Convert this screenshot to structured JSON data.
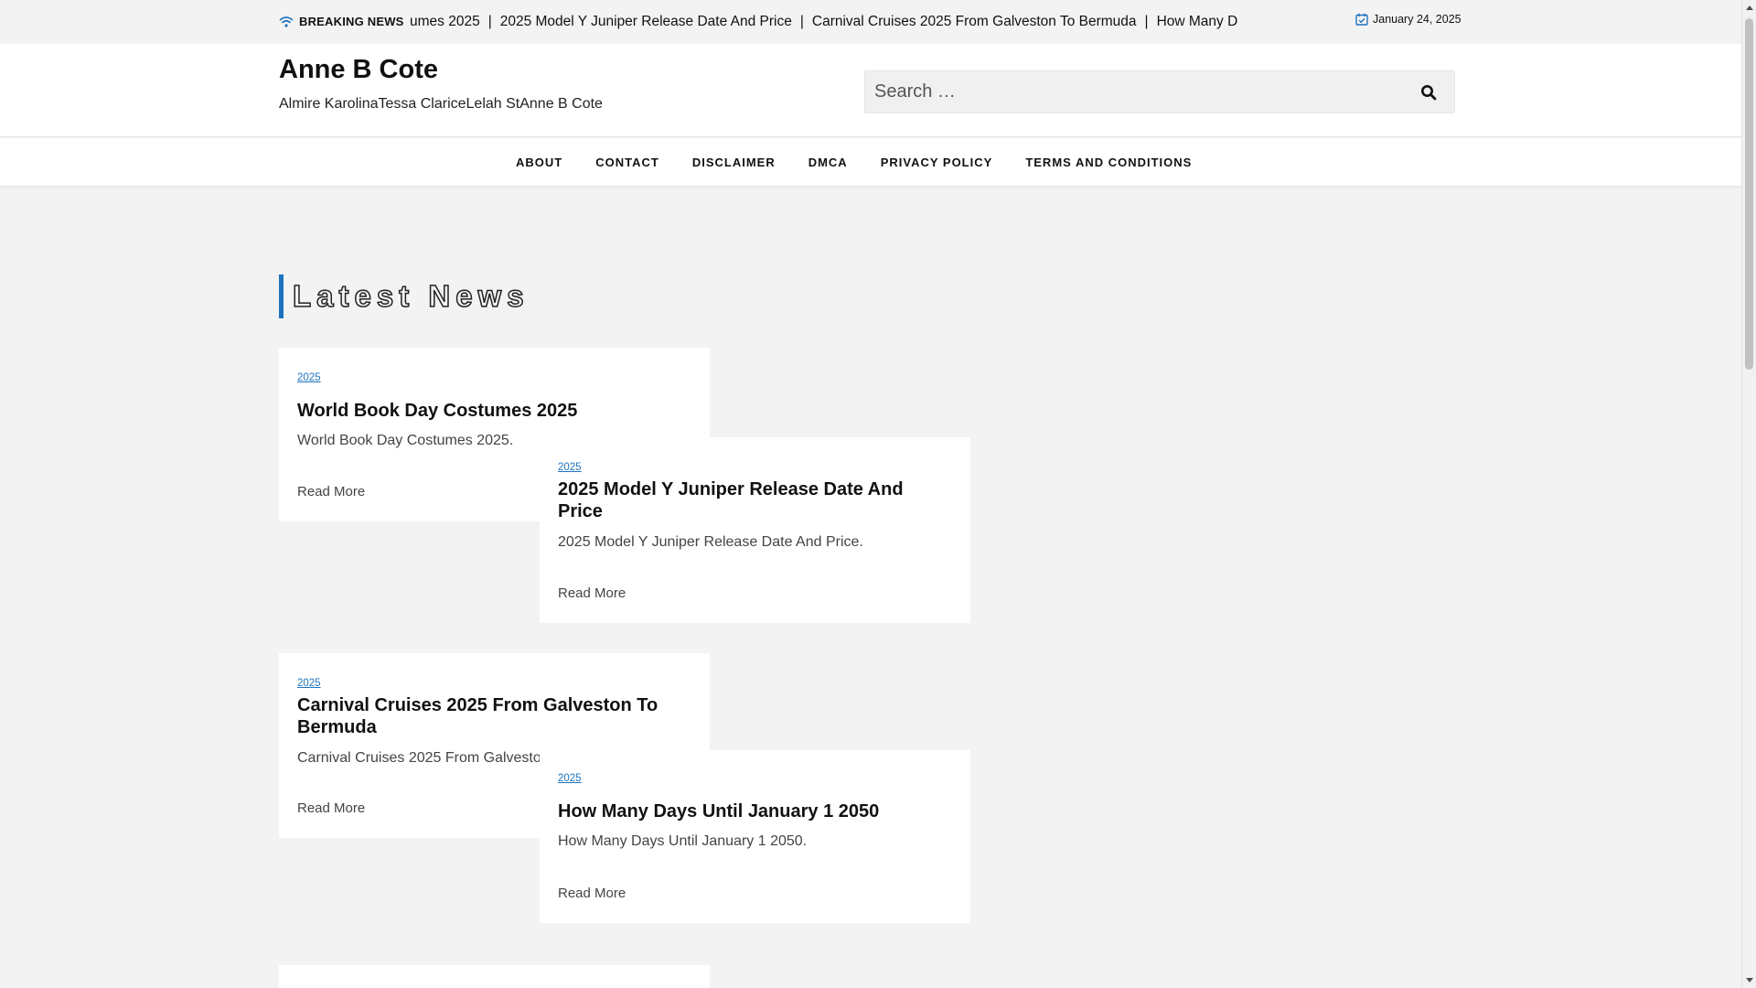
{
  "topbar": {
    "breaking_label": "BREAKING NEWS",
    "ticker_items": [
      "umes 2025",
      "2025 Model Y Juniper Release Date And Price",
      "Carnival Cruises 2025 From Galveston To Bermuda",
      "How Many D"
    ],
    "separator": "|",
    "date": "January 24, 2025",
    "icons": [
      "wifi-icon",
      "calendar-check-icon"
    ]
  },
  "header": {
    "site_title": "Anne B Cote",
    "site_description": "Almire KarolinaTessa ClariceLelah StAnne B Cote",
    "search_placeholder": "Search …",
    "search_icon": "search-icon"
  },
  "nav": {
    "items": [
      "ABOUT",
      "CONTACT",
      "DISCLAIMER",
      "DMCA",
      "PRIVACY POLICY",
      "TERMS AND CONDITIONS"
    ]
  },
  "section": {
    "heading": "Latest News"
  },
  "posts": [
    {
      "category": "2025",
      "title": "World Book Day Costumes 2025",
      "excerpt": "World Book Day Costumes 2025.",
      "read_more": "Read More"
    },
    {
      "category": "2025",
      "title": "2025 Model Y Juniper Release Date And Price",
      "excerpt": "2025 Model Y Juniper Release Date And Price.",
      "read_more": "Read More"
    },
    {
      "category": "2025",
      "title": "Carnival Cruises 2025 From Galveston To Bermuda",
      "excerpt": "Carnival Cruises 2025 From Galvesto",
      "read_more": "Read More"
    },
    {
      "category": "2025",
      "title": "How Many Days Until January 1 2050",
      "excerpt": "How Many Days Until January 1 2050.",
      "read_more": "Read More"
    }
  ],
  "colors": {
    "accent": "#1e73be",
    "background": "#f3f3f4",
    "card": "#ffffff"
  }
}
